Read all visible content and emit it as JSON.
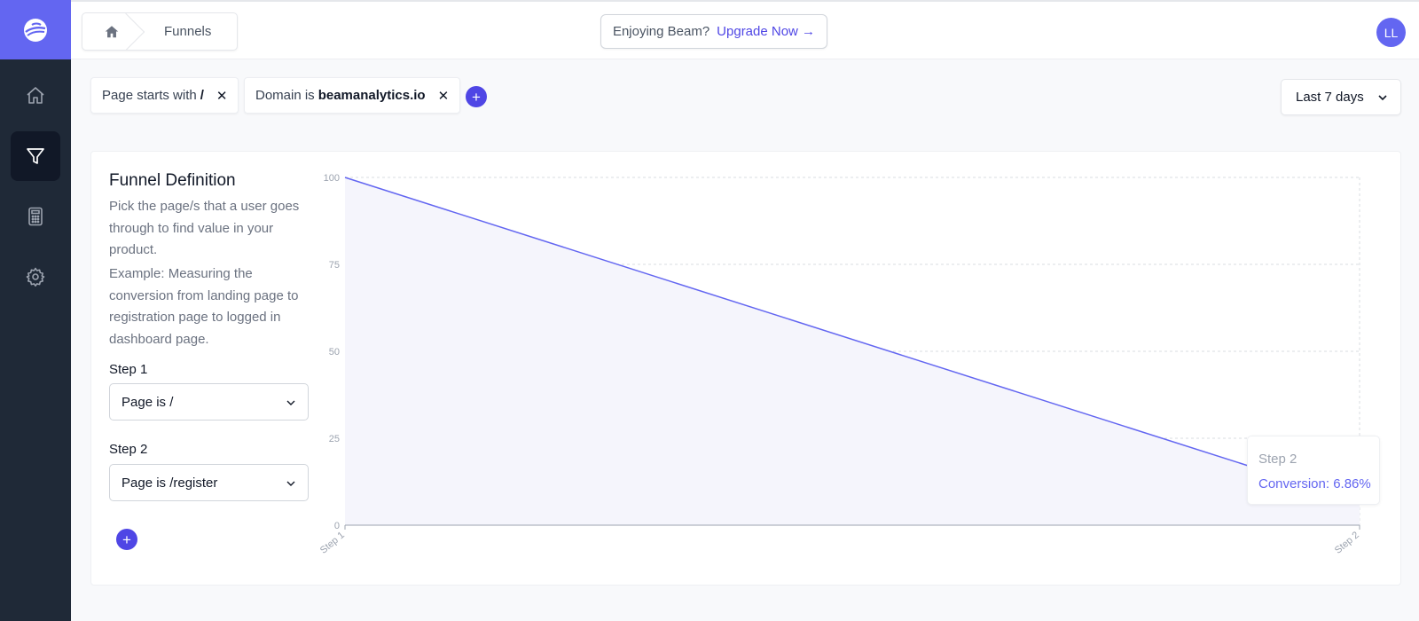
{
  "header": {
    "breadcrumb": "Funnels",
    "upgrade_prompt": "Enjoying Beam?",
    "upgrade_link": "Upgrade Now →",
    "avatar_initials": "LL"
  },
  "sidebar": {
    "items": [
      {
        "icon": "home-icon"
      },
      {
        "icon": "funnel-icon",
        "active": true
      },
      {
        "icon": "calculator-icon"
      },
      {
        "icon": "gear-icon"
      }
    ]
  },
  "filters": [
    {
      "prefix": "Page starts with",
      "value": "/"
    },
    {
      "prefix": "Domain is",
      "value": "beamanalytics.io"
    }
  ],
  "date_range": "Last 7 days",
  "funnel": {
    "title": "Funnel Definition",
    "description": "Pick the page/s that a user goes through to find value in your product.",
    "example": "Example: Measuring the conversion from landing page to registration page to logged in dashboard page.",
    "steps": [
      {
        "label": "Step 1",
        "value": "Page is /"
      },
      {
        "label": "Step 2",
        "value": "Page is /register"
      }
    ]
  },
  "tooltip": {
    "title": "Step 2",
    "text": "Conversion: 6.86%"
  },
  "colors": {
    "accent": "#6366f1",
    "sidebar": "#1f2937",
    "area_fill": "#f5f5fc"
  },
  "chart_data": {
    "type": "area",
    "x": [
      "Step 1",
      "Step 2"
    ],
    "values": [
      100,
      6.86
    ],
    "ylim": [
      0,
      100
    ],
    "yticks": [
      0,
      25,
      50,
      75,
      100
    ],
    "grid": true
  }
}
